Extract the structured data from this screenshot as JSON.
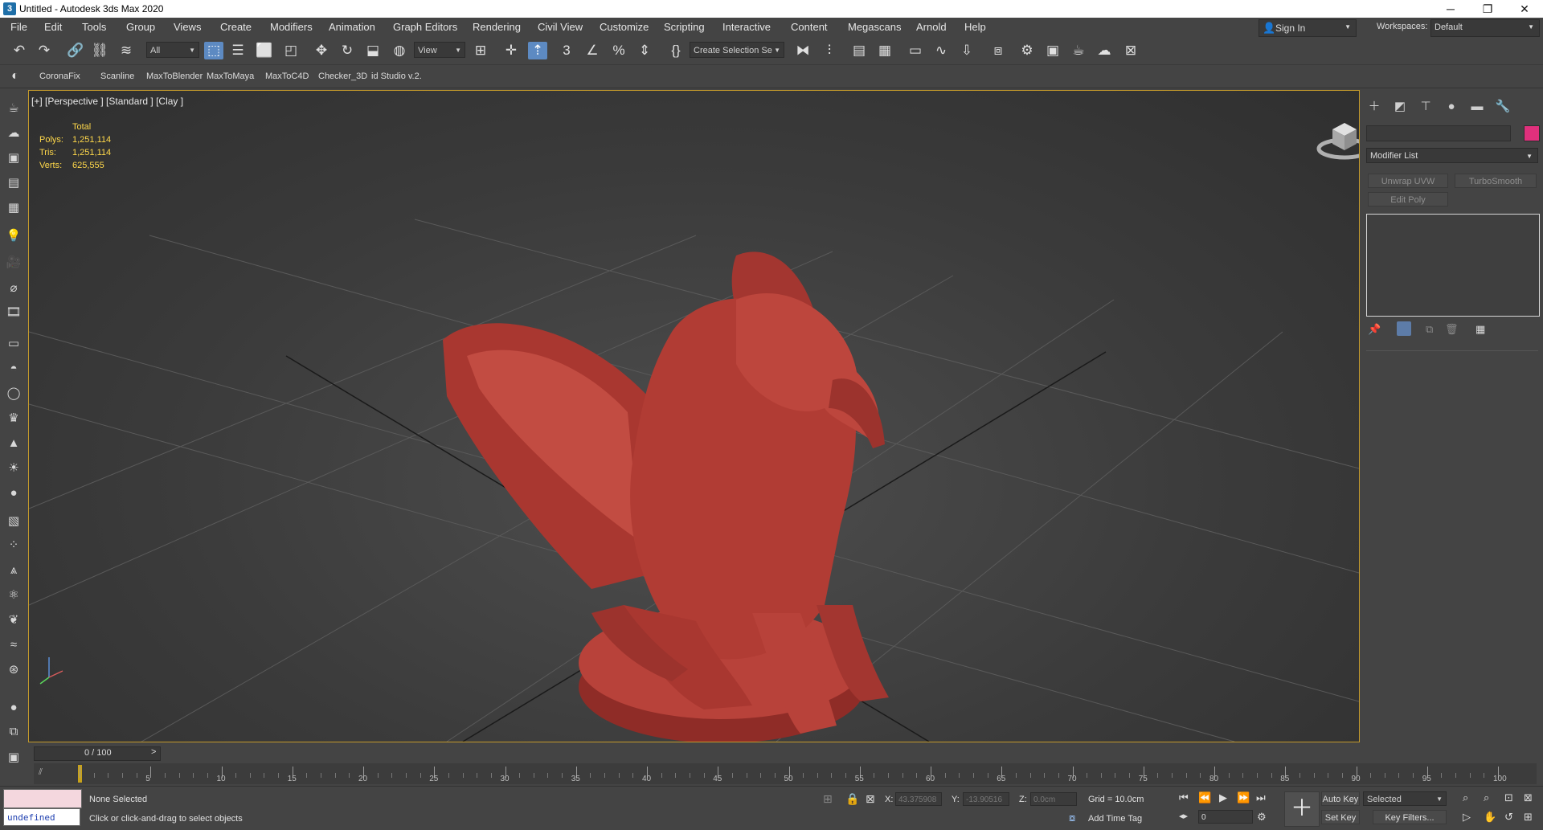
{
  "window": {
    "title": "Untitled - Autodesk 3ds Max 2020",
    "minimize": "─",
    "maximize": "❐",
    "close": "✕",
    "app_icon": "3"
  },
  "menu": [
    "File",
    "Edit",
    "Tools",
    "Group",
    "Views",
    "Create",
    "Modifiers",
    "Animation",
    "Graph Editors",
    "Rendering",
    "Civil View",
    "Customize",
    "Scripting",
    "Interactive",
    "Content",
    "Megascans",
    "Arnold",
    "Help"
  ],
  "signin": {
    "label": "Sign In"
  },
  "workspaces": {
    "label": "Workspaces:",
    "value": "Default"
  },
  "toolbar": {
    "filter": "All",
    "view": "View",
    "selection_set": "Create Selection Se"
  },
  "shelf": [
    "CoronaFix",
    "Scanline",
    "MaxToBlender",
    "MaxToMaya",
    "MaxToC4D",
    "Checker_3D",
    "id Studio v.2."
  ],
  "viewport": {
    "label": "[+] [Perspective ] [Standard ] [Clay ]",
    "stats": {
      "header": "Total",
      "polys_label": "Polys:",
      "polys": "1,251,114",
      "tris_label": "Tris:",
      "tris": "1,251,114",
      "verts_label": "Verts:",
      "verts": "625,555"
    },
    "model_color": "#b03a32"
  },
  "command_panel": {
    "modifier_list": "Modifier List",
    "btn_unwrap": "Unwrap UVW",
    "btn_turbosmooth": "TurboSmooth",
    "btn_editpoly": "Edit Poly",
    "object_color": "#e0307c"
  },
  "timeline": {
    "frame": "0 / 100",
    "ticks": [
      0,
      5,
      10,
      15,
      20,
      25,
      30,
      35,
      40,
      45,
      50,
      55,
      60,
      65,
      70,
      75,
      80,
      85,
      90,
      95,
      100
    ]
  },
  "status": {
    "script_field": "undefined",
    "selection": "None Selected",
    "prompt": "Click or click-and-drag to select objects",
    "x_label": "X:",
    "x": "43.375908",
    "y_label": "Y:",
    "y": "-13.90516",
    "z_label": "Z:",
    "z": "0.0cm",
    "grid": "Grid = 10.0cm",
    "add_time_tag": "Add Time Tag",
    "auto_key": "Auto Key",
    "set_key": "Set Key",
    "key_mode": "Selected",
    "key_filters": "Key Filters...",
    "current_frame": "0"
  }
}
